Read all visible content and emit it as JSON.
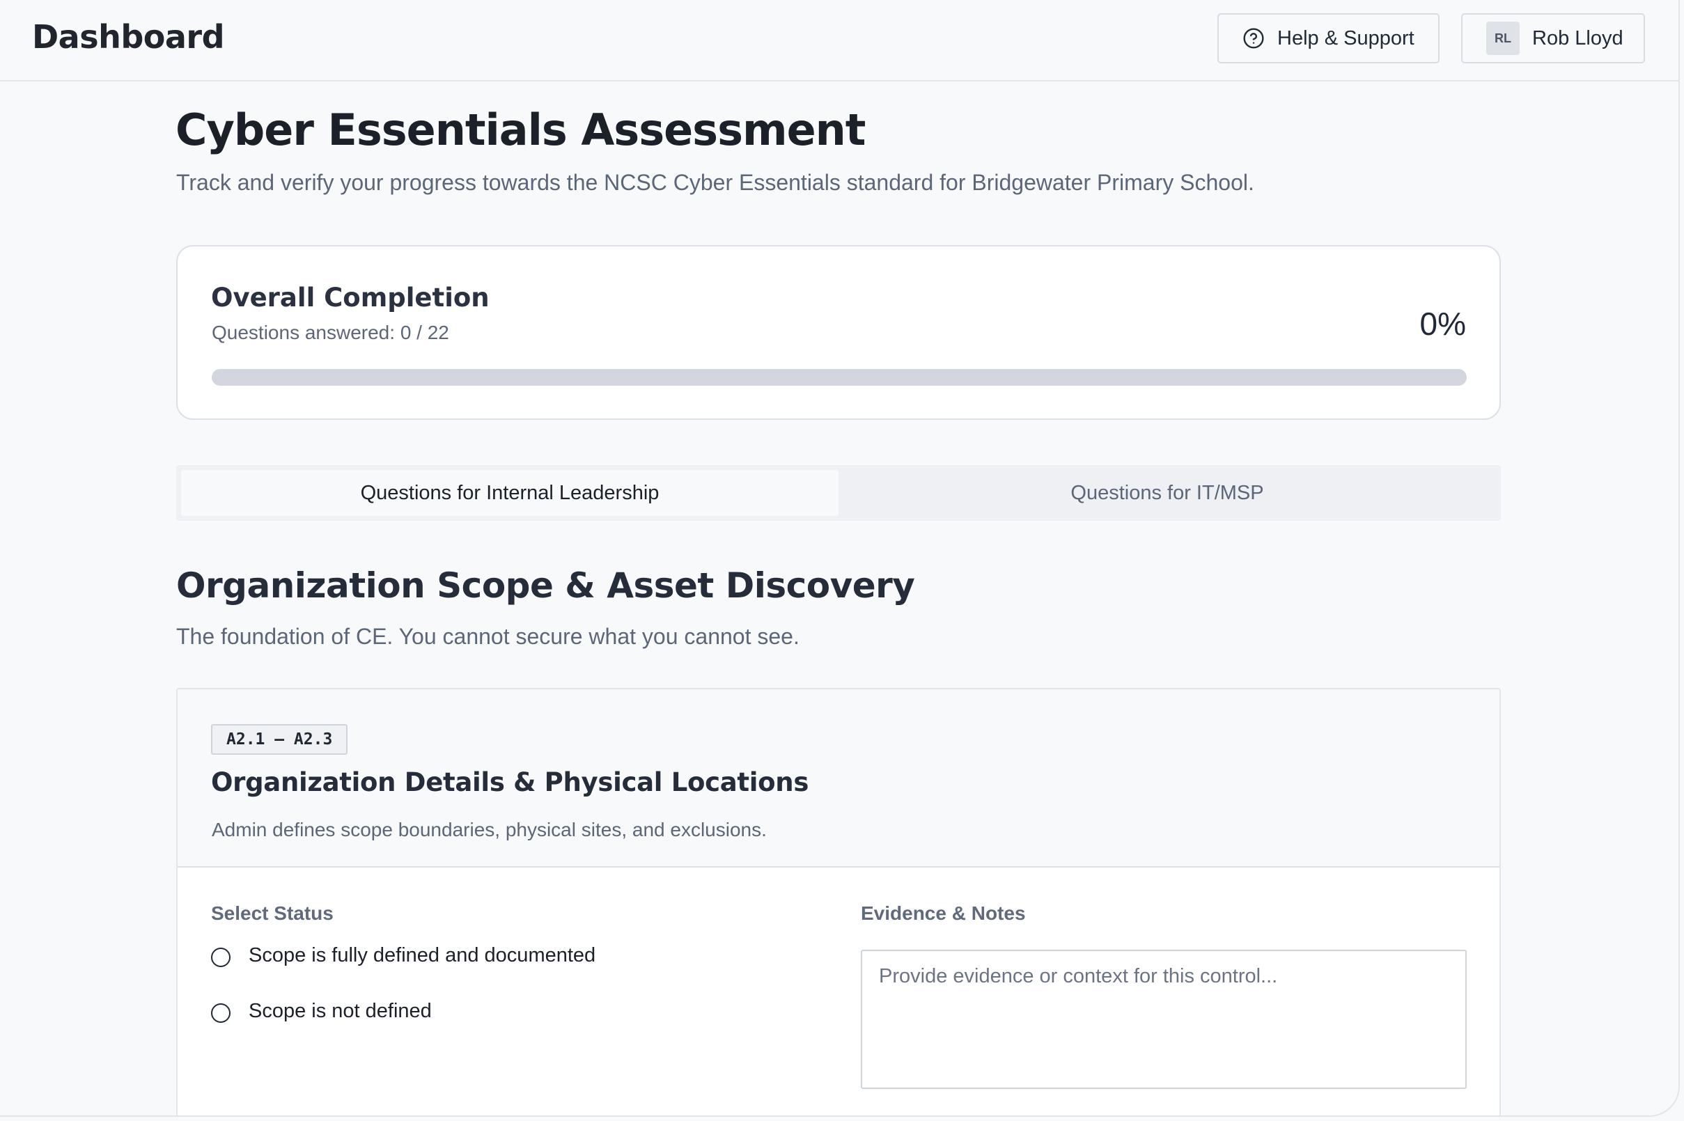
{
  "header": {
    "title": "Dashboard",
    "help_label": "Help & Support",
    "user_initials": "RL",
    "user_name": "Rob Lloyd"
  },
  "page": {
    "title": "Cyber Essentials Assessment",
    "subtitle": "Track and verify your progress towards the NCSC Cyber Essentials standard for Bridgewater Primary School."
  },
  "completion": {
    "title": "Overall Completion",
    "answered_text": "Questions answered: 0 / 22",
    "percent_text": "0%",
    "progress_fraction": 0
  },
  "tabs": [
    {
      "label": "Questions for Internal Leadership",
      "active": true
    },
    {
      "label": "Questions for IT/MSP",
      "active": false
    }
  ],
  "section": {
    "title": "Organization Scope & Asset Discovery",
    "subtitle": "The foundation of CE. You cannot secure what you cannot see."
  },
  "question": {
    "code": "A2.1 – A2.3",
    "title": "Organization Details & Physical Locations",
    "description": "Admin defines scope boundaries, physical sites, and exclusions.",
    "status_label": "Select Status",
    "options": [
      {
        "label": "Scope is fully defined and documented",
        "selected": false
      },
      {
        "label": "Scope is not defined",
        "selected": false
      }
    ],
    "evidence_label": "Evidence & Notes",
    "evidence_value": "",
    "evidence_placeholder": "Provide evidence or context for this control..."
  },
  "colors": {
    "background": "#f8f9fb",
    "progress_track": "#d3d6de",
    "text_primary": "#1b2029",
    "text_muted": "#5b6678",
    "corner_accent": "#b52a4d"
  }
}
